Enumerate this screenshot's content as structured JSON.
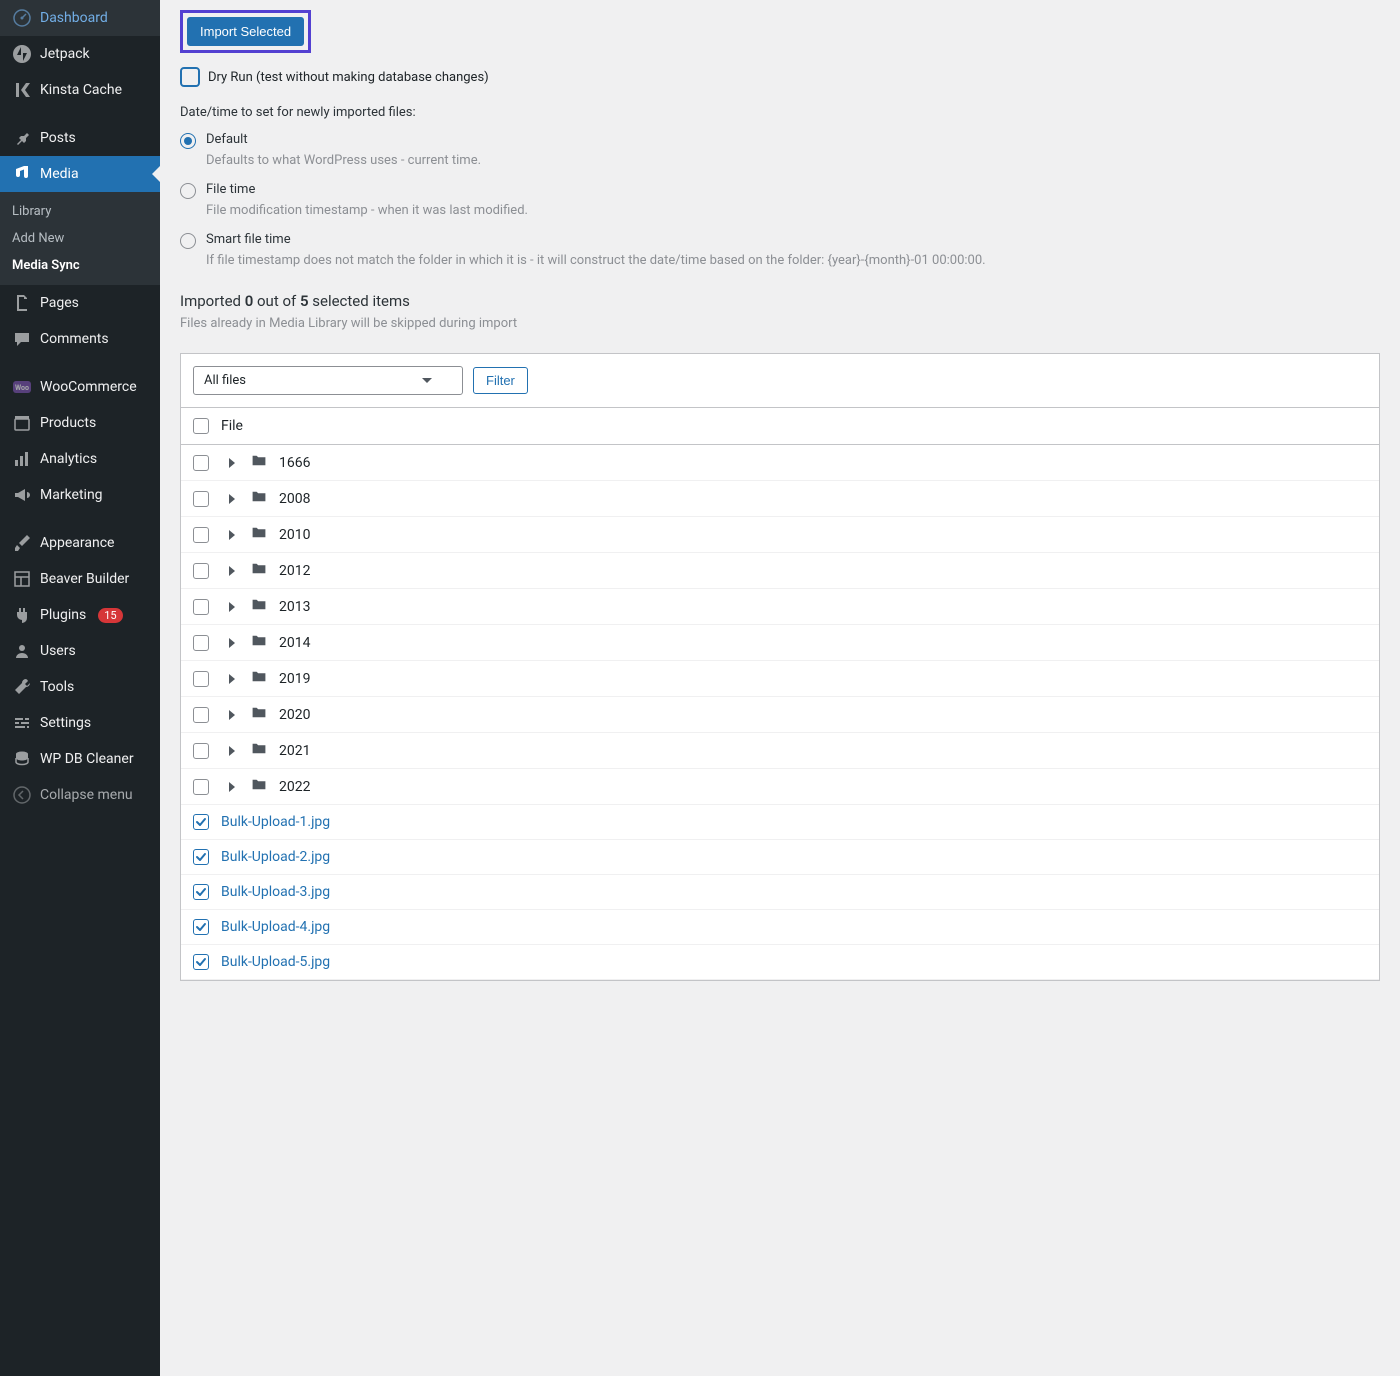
{
  "sidebar": {
    "items": [
      {
        "label": "Dashboard",
        "icon": "dashboard"
      },
      {
        "label": "Jetpack",
        "icon": "jetpack"
      },
      {
        "label": "Kinsta Cache",
        "icon": "kinsta"
      }
    ],
    "items2": [
      {
        "label": "Posts",
        "icon": "pin"
      },
      {
        "label": "Media",
        "icon": "media",
        "current": true
      }
    ],
    "submenu": [
      {
        "label": "Library"
      },
      {
        "label": "Add New"
      },
      {
        "label": "Media Sync",
        "current": true
      }
    ],
    "items3": [
      {
        "label": "Pages",
        "icon": "pages"
      },
      {
        "label": "Comments",
        "icon": "comments"
      }
    ],
    "items4": [
      {
        "label": "WooCommerce",
        "icon": "woo"
      },
      {
        "label": "Products",
        "icon": "products"
      },
      {
        "label": "Analytics",
        "icon": "analytics"
      },
      {
        "label": "Marketing",
        "icon": "marketing"
      }
    ],
    "items5": [
      {
        "label": "Appearance",
        "icon": "appearance"
      },
      {
        "label": "Beaver Builder",
        "icon": "beaver"
      },
      {
        "label": "Plugins",
        "icon": "plugins",
        "badge": "15"
      },
      {
        "label": "Users",
        "icon": "users"
      },
      {
        "label": "Tools",
        "icon": "tools"
      },
      {
        "label": "Settings",
        "icon": "settings"
      },
      {
        "label": "WP DB Cleaner",
        "icon": "db"
      }
    ],
    "collapse": "Collapse menu"
  },
  "main": {
    "import_button": "Import Selected",
    "dryrun_label": "Dry Run (test without making database changes)",
    "datetime_heading": "Date/time to set for newly imported files:",
    "radios": [
      {
        "label": "Default",
        "desc": "Defaults to what WordPress uses - current time.",
        "checked": true
      },
      {
        "label": "File time",
        "desc": "File modification timestamp - when it was last modified."
      },
      {
        "label": "Smart file time",
        "desc": "If file timestamp does not match the folder in which it is - it will construct the date/time based on the folder: {year}-{month}-01 00:00:00."
      }
    ],
    "counter_prefix": "Imported ",
    "counter_done": "0",
    "counter_mid": " out of ",
    "counter_total": "5",
    "counter_suffix": " selected items",
    "counter_sub": "Files already in Media Library will be skipped during import",
    "filter": {
      "select": "All files",
      "button": "Filter"
    },
    "table": {
      "header": "File",
      "rows": [
        {
          "type": "folder",
          "name": "1666"
        },
        {
          "type": "folder",
          "name": "2008"
        },
        {
          "type": "folder",
          "name": "2010"
        },
        {
          "type": "folder",
          "name": "2012"
        },
        {
          "type": "folder",
          "name": "2013"
        },
        {
          "type": "folder",
          "name": "2014"
        },
        {
          "type": "folder",
          "name": "2019"
        },
        {
          "type": "folder",
          "name": "2020"
        },
        {
          "type": "folder",
          "name": "2021"
        },
        {
          "type": "folder",
          "name": "2022"
        },
        {
          "type": "file",
          "name": "Bulk-Upload-1.jpg",
          "checked": true
        },
        {
          "type": "file",
          "name": "Bulk-Upload-2.jpg",
          "checked": true
        },
        {
          "type": "file",
          "name": "Bulk-Upload-3.jpg",
          "checked": true
        },
        {
          "type": "file",
          "name": "Bulk-Upload-4.jpg",
          "checked": true
        },
        {
          "type": "file",
          "name": "Bulk-Upload-5.jpg",
          "checked": true
        }
      ]
    }
  }
}
